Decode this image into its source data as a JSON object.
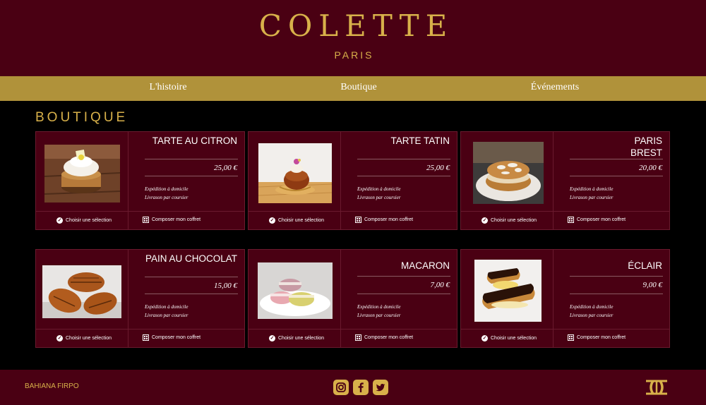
{
  "header": {
    "brand": "COLETTE",
    "subtitle": "PARIS"
  },
  "nav": {
    "items": [
      "L'histoire",
      "Boutique",
      "Événements"
    ]
  },
  "section": {
    "title": "BOUTIQUE"
  },
  "products": [
    {
      "name": "TARTE AU CITRON",
      "price": "25,00 €",
      "shipping": "Expédition à domicile",
      "delivery": "Livrason par coursier",
      "select_label": "Choisir une sélection",
      "box_label": "Composer mon coffret"
    },
    {
      "name": "TARTE TATIN",
      "price": "25,00 €",
      "shipping": "Expédition à domicile",
      "delivery": "Livrason par coursier",
      "select_label": "Choisir une sélection",
      "box_label": "Composer mon coffret"
    },
    {
      "name": "PARIS BREST",
      "price": "20,00 €",
      "shipping": "Expédition à domicile",
      "delivery": "Livrason par coursier",
      "select_label": "Choisir une sélection",
      "box_label": "Composer mon coffret"
    },
    {
      "name": "PAIN AU CHOCOLAT",
      "price": "15,00 €",
      "shipping": "Expédition à domicile",
      "delivery": "Livrason par coursier",
      "select_label": "Choisir une sélection",
      "box_label": "Composer mon coffret"
    },
    {
      "name": "MACARON",
      "price": "7,00 €",
      "shipping": "Expédition à domicile",
      "delivery": "Livrason par coursier",
      "select_label": "Choisir une sélection",
      "box_label": "Composer mon coffret"
    },
    {
      "name": "ÉCLAIR",
      "price": "9,00 €",
      "shipping": "Expédition à domicile",
      "delivery": "Livrason par coursier",
      "select_label": "Choisir une sélection",
      "box_label": "Composer mon coffret"
    }
  ],
  "footer": {
    "author": "BAHIANA FIRPO",
    "social": [
      "instagram-icon",
      "facebook-icon",
      "twitter-icon"
    ]
  },
  "colors": {
    "burgundy": "#4a0013",
    "gold": "#d8b14a",
    "nav_gold": "#b0923a",
    "background": "#000000"
  }
}
